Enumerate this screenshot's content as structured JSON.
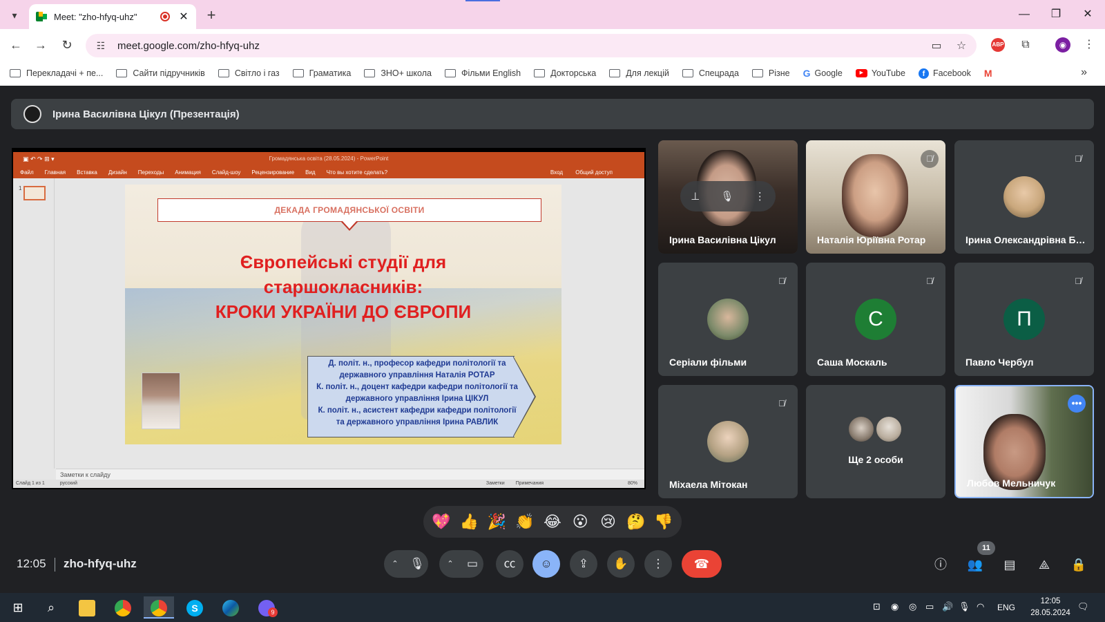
{
  "browser": {
    "tab": {
      "title": "Meet: \"zho-hfyq-uhz\"",
      "close": "✕"
    },
    "new_tab": "+",
    "url": "meet.google.com/zho-hfyq-uhz",
    "bookmarks": [
      "Перекладачі + пе...",
      "Сайти підручників",
      "Світло і газ",
      "Граматика",
      "ЗНО+ школа",
      "Фільми English",
      "Докторська",
      "Для лекцій",
      "Спецрада",
      "Різне",
      "Google",
      "YouTube",
      "Facebook"
    ],
    "abp_label": "ABP"
  },
  "presenter": {
    "label": "Ірина Василівна Цікул (Презентація)"
  },
  "powerpoint": {
    "window_title": "Громадянська освіта (28.05.2024) - PowerPoint",
    "ribbon_tabs": [
      "Файл",
      "Главная",
      "Вставка",
      "Дизайн",
      "Переходы",
      "Анимация",
      "Слайд-шоу",
      "Рецензирование",
      "Вид",
      "Что вы хотите сделать?"
    ],
    "sign_in": "Вход",
    "share": "Общий доступ",
    "thumb_number": "1",
    "notes_placeholder": "Заметки к слайду",
    "status_left": "Слайд 1 из 1",
    "status_lang": "русский",
    "status_notes": "Заметки",
    "status_comments": "Примечания",
    "zoom": "80%",
    "slide": {
      "header": "ДЕКАДА ГРОМАДЯНСЬКОЇ ОСВІТИ",
      "title_lines": [
        "Європейські студії для",
        "старшокласників:",
        "КРОКИ УКРАЇНИ ДО ЄВРОПИ"
      ],
      "authors": [
        "Д. політ. н., професор кафедри політології та",
        "державного управління Наталія РОТАР",
        "К. політ. н., доцент кафедри кафедри політології та",
        "державного управління  Ірина ЦІКУЛ",
        "К. політ. н., асистент кафедри кафедри політології",
        "та державного управління  Ірина РАВЛИК"
      ]
    }
  },
  "participants": [
    {
      "name": "Ірина Василівна Цікул",
      "type": "video1",
      "muted": false
    },
    {
      "name": "Наталія Юріївна Ротар",
      "type": "video2",
      "muted": true
    },
    {
      "name": "Ірина Олександрівна Бондаренко",
      "type": "photo",
      "muted": true,
      "avatar_color": "#c9a77c"
    },
    {
      "name": "Серіали фільми",
      "type": "photo",
      "muted": true,
      "avatar_color": "#7c8a6a"
    },
    {
      "name": "Саша Москаль",
      "type": "letter",
      "letter": "С",
      "muted": true,
      "avatar_color": "#1e7e34"
    },
    {
      "name": "Павло Чербул",
      "type": "letter",
      "letter": "П",
      "muted": true,
      "avatar_color": "#0b5e45"
    },
    {
      "name": "Міхаела Мітокан",
      "type": "photo",
      "muted": true,
      "avatar_color": "#b5a284"
    },
    {
      "name": "Ще 2 особи",
      "type": "others",
      "muted": false
    },
    {
      "name": "Любов Мельничук",
      "type": "video3",
      "muted": false
    }
  ],
  "reactions": [
    "💖",
    "👍",
    "🎉",
    "👏",
    "😂",
    "😮",
    "😢",
    "🤔",
    "👎"
  ],
  "meeting": {
    "time": "12:05",
    "code": "zho-hfyq-uhz",
    "participant_count": "11"
  },
  "taskbar": {
    "lang": "ENG",
    "time": "12:05",
    "date": "28.05.2024",
    "viber_badge": "9"
  },
  "colors": {
    "meet_bg": "#202124",
    "tile_bg": "#3c4043",
    "end_call": "#ea4335",
    "accent_blue": "#8ab4f8",
    "ppt_orange": "#c54b1e",
    "tab_strip": "#f6d4ea"
  }
}
